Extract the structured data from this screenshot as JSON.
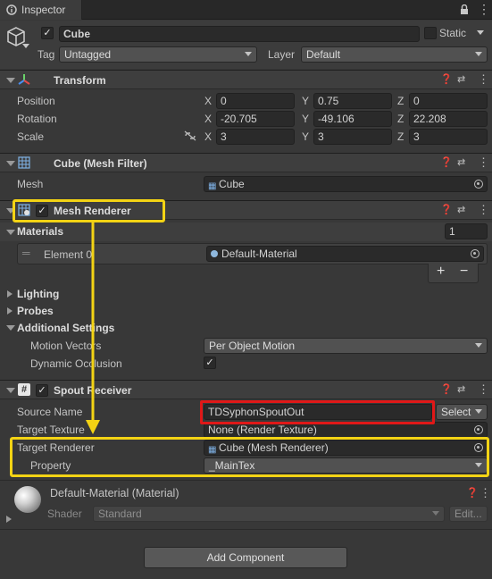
{
  "window": {
    "tab_title": "Inspector"
  },
  "object": {
    "name": "Cube",
    "static_label": "Static",
    "tag_label": "Tag",
    "tag_value": "Untagged",
    "layer_label": "Layer",
    "layer_value": "Default"
  },
  "transform": {
    "title": "Transform",
    "position_label": "Position",
    "rotation_label": "Rotation",
    "scale_label": "Scale",
    "axes": [
      "X",
      "Y",
      "Z"
    ],
    "position": [
      "0",
      "0.75",
      "0"
    ],
    "rotation": [
      "-20.705",
      "-49.106",
      "22.208"
    ],
    "scale": [
      "3",
      "3",
      "3"
    ]
  },
  "mesh_filter": {
    "title": "Cube (Mesh Filter)",
    "mesh_label": "Mesh",
    "mesh_value": "Cube"
  },
  "mesh_renderer": {
    "title": "Mesh Renderer",
    "materials_label": "Materials",
    "materials_count": "1",
    "element_label": "Element 0",
    "element_value": "Default-Material",
    "add_label": "+",
    "remove_label": "−",
    "lighting_label": "Lighting",
    "probes_label": "Probes",
    "additional_label": "Additional Settings",
    "motion_vectors_label": "Motion Vectors",
    "motion_vectors_value": "Per Object Motion",
    "dynamic_occlusion_label": "Dynamic Occlusion"
  },
  "spout_receiver": {
    "title": "Spout Receiver",
    "source_name_label": "Source Name",
    "source_name_value": "TDSyphonSpoutOut",
    "select_label": "Select",
    "target_texture_label": "Target Texture",
    "target_texture_value": "None (Render Texture)",
    "target_renderer_label": "Target Renderer",
    "target_renderer_value": "Cube (Mesh Renderer)",
    "property_label": "Property",
    "property_value": "_MainTex"
  },
  "material": {
    "title": "Default-Material (Material)",
    "shader_label": "Shader",
    "shader_value": "Standard",
    "edit_label": "Edit..."
  },
  "footer": {
    "add_component_label": "Add Component"
  },
  "colors": {
    "highlight_yellow": "#f3d314",
    "highlight_red": "#e01818",
    "background": "#383838"
  },
  "icons": [
    "cube-icon",
    "transform-icon",
    "mesh-filter-icon",
    "mesh-renderer-icon",
    "script-icon",
    "material-sphere-icon",
    "help-icon",
    "presets-icon",
    "kebab-menu-icon",
    "lock-icon",
    "object-picker-icon",
    "constrain-proportions-icon"
  ]
}
